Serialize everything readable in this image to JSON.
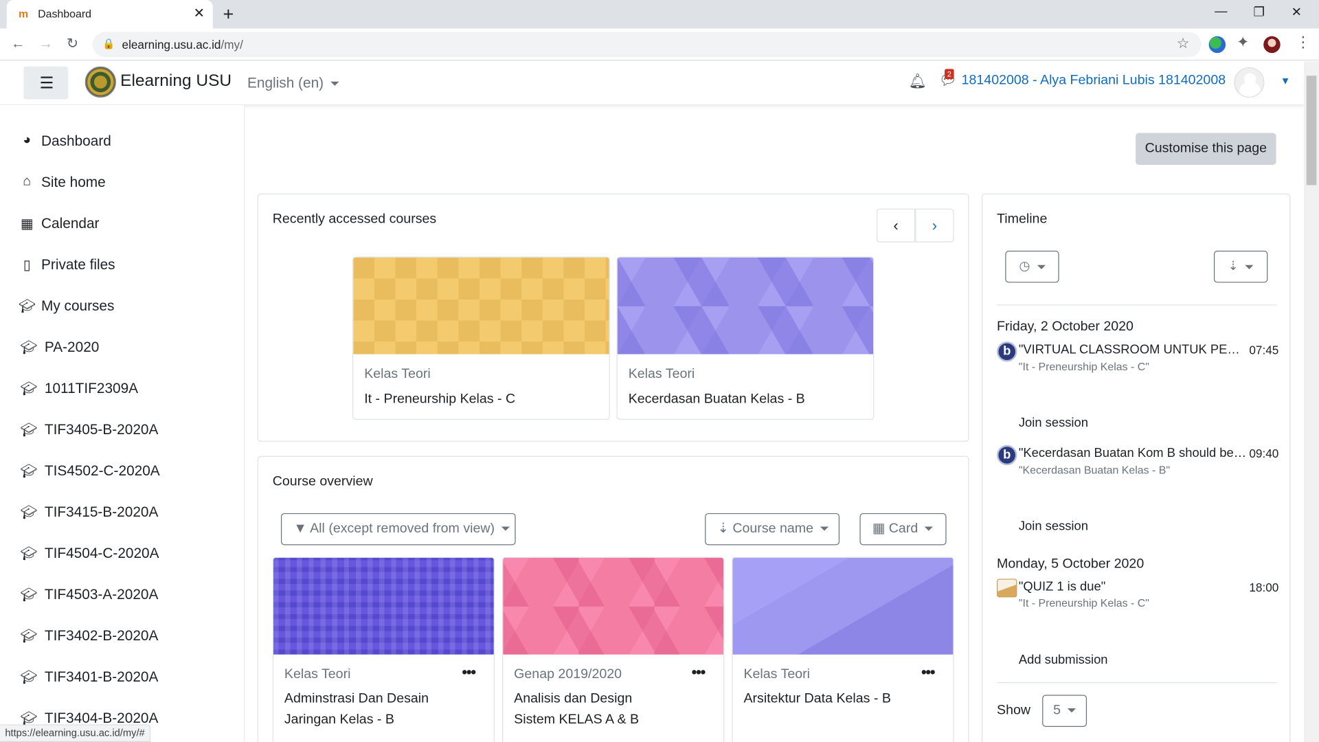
{
  "browser": {
    "tab_title": "Dashboard",
    "url_host": "elearning.usu.ac.id",
    "url_path": "/my/",
    "status_url": "https://elearning.usu.ac.id/my/#"
  },
  "navbar": {
    "site_name": "Elearning USU",
    "language": "English (en)",
    "message_count": "2",
    "user_name": "181402008 - Alya Febriani Lubis 181402008"
  },
  "sidebar": {
    "items": [
      {
        "label": "Dashboard",
        "icon": "dashboard-icon"
      },
      {
        "label": "Site home",
        "icon": "home-icon"
      },
      {
        "label": "Calendar",
        "icon": "calendar-icon"
      },
      {
        "label": "Private files",
        "icon": "file-icon"
      },
      {
        "label": "My courses",
        "icon": "graduation-cap-icon"
      }
    ],
    "courses": [
      "PA-2020",
      "1011TIF2309A",
      "TIF3405-B-2020A",
      "TIS4502-C-2020A",
      "TIF3415-B-2020A",
      "TIF4504-C-2020A",
      "TIF4503-A-2020A",
      "TIF3402-B-2020A",
      "TIF3401-B-2020A",
      "TIF3404-B-2020A"
    ]
  },
  "main": {
    "customise_label": "Customise this page",
    "recent": {
      "title": "Recently accessed courses",
      "courses": [
        {
          "category": "Kelas Teori",
          "name": "It - Preneurship Kelas - C"
        },
        {
          "category": "Kelas Teori",
          "name": "Kecerdasan Buatan Kelas - B"
        }
      ]
    },
    "overview": {
      "title": "Course overview",
      "filter_label": "All (except removed from view)",
      "sort_label": "Course name",
      "view_label": "Card",
      "courses": [
        {
          "category": "Kelas Teori",
          "name_line1": "Adminstrasi Dan Desain",
          "name_line2": "Jaringan Kelas - B"
        },
        {
          "category": "Genap 2019/2020",
          "name_line1": "Analisis dan Design",
          "name_line2": "Sistem KELAS A & B"
        },
        {
          "category": "Kelas Teori",
          "name_line1": "Arsitektur Data Kelas - B",
          "name_line2": ""
        }
      ]
    }
  },
  "timeline": {
    "title": "Timeline",
    "groups": [
      {
        "date": "Friday, 2 October 2020",
        "events": [
          {
            "title": "\"VIRTUAL CLASSROOM UNTUK PERTEMUAN\"",
            "course": "\"It - Preneurship Kelas - C\"",
            "time": "07:45",
            "action": "Join session",
            "icon": "bigbluebutton-icon"
          },
          {
            "title": "\"Kecerdasan Buatan Kom B should be closed\"",
            "course": "\"Kecerdasan Buatan Kelas - B\"",
            "time": "09:40",
            "action": "Join session",
            "icon": "bigbluebutton-icon"
          }
        ]
      },
      {
        "date": "Monday, 5 October 2020",
        "events": [
          {
            "title": "\"QUIZ 1 is due\"",
            "course": "\"It - Preneurship Kelas - C\"",
            "time": "18:00",
            "action": "Add submission",
            "icon": "assignment-icon"
          }
        ]
      }
    ],
    "show_label": "Show",
    "show_value": "5"
  }
}
